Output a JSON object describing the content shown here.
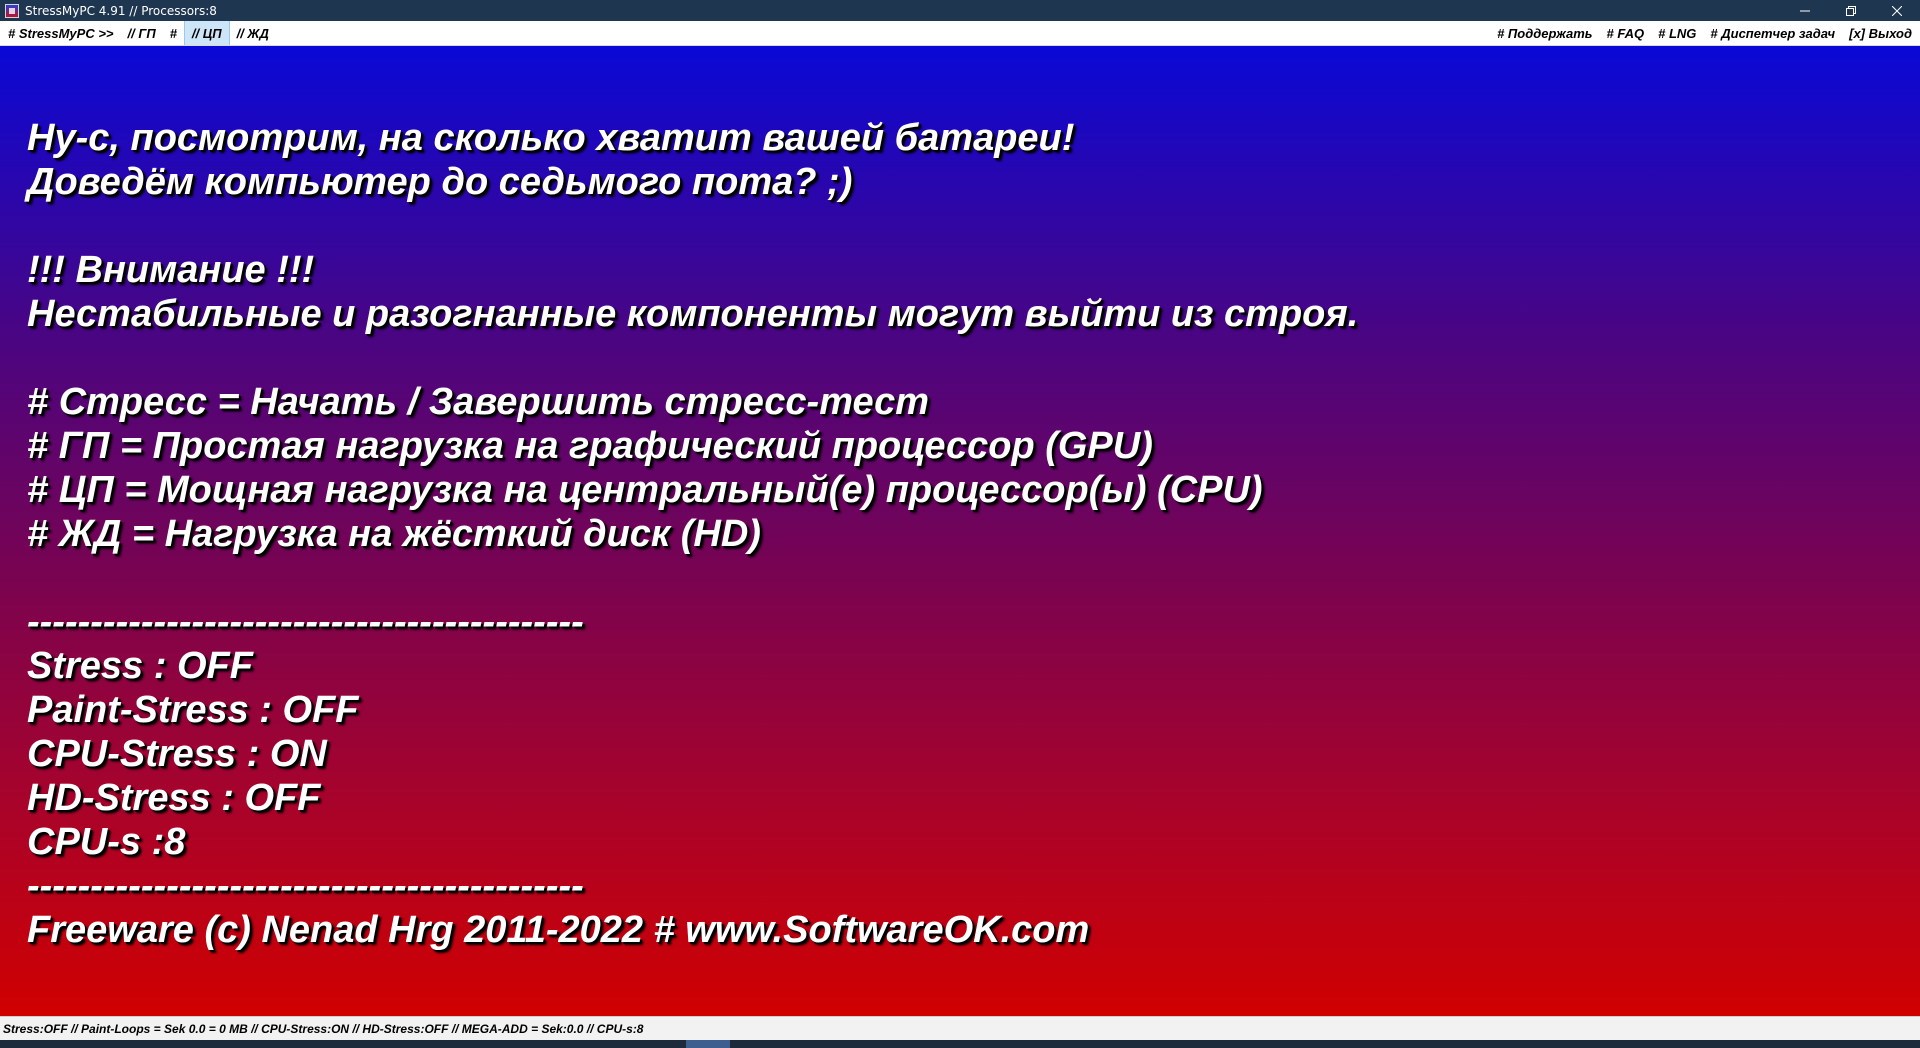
{
  "window": {
    "title": "StressMyPC 4.91 // Processors:8",
    "controls": {
      "minimize_icon": "minimize-icon",
      "restore_icon": "restore-icon",
      "close_icon": "close-icon"
    }
  },
  "menu": {
    "left": [
      {
        "label": "# StressMyPC >>",
        "active": false
      },
      {
        "label": "// ГП",
        "active": false
      },
      {
        "label": "#",
        "active": false
      },
      {
        "label": "// ЦП",
        "active": true
      },
      {
        "label": "// ЖД",
        "active": false
      }
    ],
    "right": [
      {
        "label": "# Поддержать"
      },
      {
        "label": "# FAQ"
      },
      {
        "label": "# LNG"
      },
      {
        "label": "# Диспетчер задач"
      },
      {
        "label": "[x] Выход"
      }
    ]
  },
  "main": {
    "intro": [
      "Ну-с, посмотрим, на сколько хватит вашей батареи!",
      "Доведём компьютер до седьмого пота? ;)"
    ],
    "warning": [
      "!!! Внимание !!!",
      "Нестабильные и разогнанные компоненты могут выйти из строя."
    ],
    "help": [
      "# Стресс = Начать / Завершить стресс-тест",
      "# ГП = Простая нагрузка на графический процессор (GPU)",
      "# ЦП = Мощная нагрузка на центральный(е) процессор(ы) (CPU)",
      "# ЖД = Нагрузка на жёсткий диск (HD)"
    ],
    "separator": "--------------------------------------------",
    "status": [
      "Stress : OFF",
      "Paint-Stress : OFF",
      "CPU-Stress : ON",
      "HD-Stress : OFF",
      "CPU-s :8"
    ],
    "footer": "Freeware (c) Nenad Hrg 2011-2022 # www.SoftwareOK.com"
  },
  "statusbar": {
    "text": "Stress:OFF // Paint-Loops = Sek 0.0 = 0 MB // CPU-Stress:ON // HD-Stress:OFF // MEGA-ADD = Sek:0.0 // CPU-s:8"
  },
  "colors": {
    "titlebar": "#1f3651",
    "gradient_top": "#0a08d6",
    "gradient_bottom": "#d00000",
    "menu_active": "#cde6f7",
    "text": "#ffffff"
  }
}
